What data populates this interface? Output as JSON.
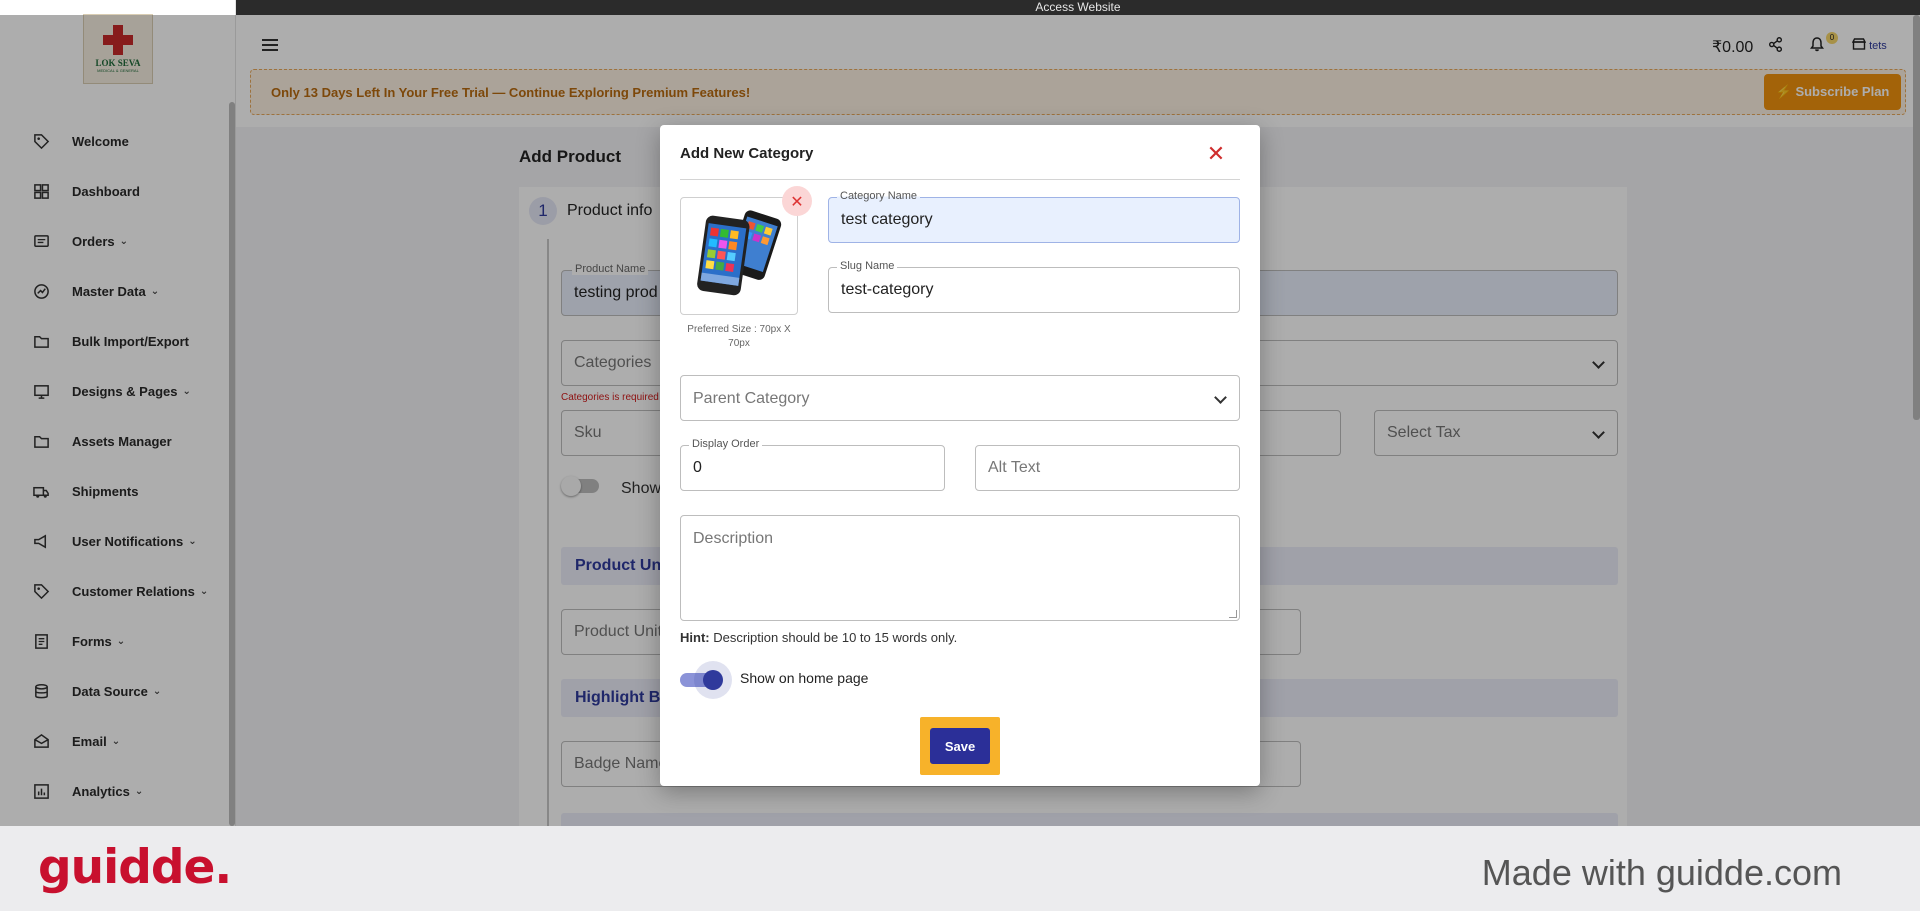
{
  "topbar": {
    "text": "Access Website"
  },
  "logo": {
    "name": "LOK SEVA",
    "tagline": "MEDICAL & GENERAL"
  },
  "sidebar": {
    "items": [
      {
        "label": "Welcome",
        "icon": "tag-icon",
        "has_chevron": false
      },
      {
        "label": "Dashboard",
        "icon": "dashboard-icon",
        "has_chevron": false
      },
      {
        "label": "Orders",
        "icon": "orders-icon",
        "has_chevron": true
      },
      {
        "label": "Master Data",
        "icon": "master-data-icon",
        "has_chevron": true
      },
      {
        "label": "Bulk Import/Export",
        "icon": "folder-icon",
        "has_chevron": false
      },
      {
        "label": "Designs & Pages",
        "icon": "designs-icon",
        "has_chevron": true
      },
      {
        "label": "Assets Manager",
        "icon": "folder-icon",
        "has_chevron": false
      },
      {
        "label": "Shipments",
        "icon": "truck-icon",
        "has_chevron": false
      },
      {
        "label": "User Notifications",
        "icon": "megaphone-icon",
        "has_chevron": true
      },
      {
        "label": "Customer Relations",
        "icon": "tag-icon",
        "has_chevron": true
      },
      {
        "label": "Forms",
        "icon": "forms-icon",
        "has_chevron": true
      },
      {
        "label": "Data Source",
        "icon": "database-icon",
        "has_chevron": true
      },
      {
        "label": "Email",
        "icon": "email-icon",
        "has_chevron": true
      },
      {
        "label": "Analytics",
        "icon": "analytics-icon",
        "has_chevron": true
      }
    ]
  },
  "header": {
    "balance": "₹0.00",
    "notification_count": "0",
    "store_name": "tets",
    "trial_banner": "Only 13 Days Left In Your Free Trial — Continue Exploring Premium Features!",
    "subscribe_label": "⚡ Subscribe Plan"
  },
  "page": {
    "title": "Add Product",
    "step_number": "1",
    "step_label": "Product info",
    "product_name_legend": "Product Name",
    "product_name_value": "testing prod",
    "categories_placeholder": "Categories",
    "categories_error": "Categories is required",
    "sku_placeholder": "Sku",
    "select_tax": "Select Tax",
    "show_label": "Show",
    "product_unit_section": "Product Uni",
    "product_unit_placeholder": "Product Unit",
    "highlight_section": "Highlight Ba",
    "badge_name_placeholder": "Badge Name"
  },
  "modal": {
    "title": "Add New Category",
    "close_symbol": "✕",
    "image_remove_symbol": "✕",
    "preferred_size": "Preferred Size : 70px X 70px",
    "category_name_legend": "Category Name",
    "category_name_value": "test category",
    "slug_legend": "Slug Name",
    "slug_value": "test-category",
    "parent_category_placeholder": "Parent Category",
    "display_order_legend": "Display Order",
    "display_order_value": "0",
    "alt_text_placeholder": "Alt Text",
    "description_placeholder": "Description",
    "hint_label": "Hint:",
    "hint_text": " Description should be 10 to 15 words only.",
    "show_home_label": "Show on home page",
    "show_home_checked": true,
    "save_label": "Save"
  },
  "footer": {
    "brand": "guidde.",
    "made_with": "Made with guidde.com"
  },
  "colors": {
    "primary": "#2f3a9c",
    "trial_accent": "#f0920e",
    "highlight": "#f7b22a",
    "brand_red": "#c8102e"
  }
}
